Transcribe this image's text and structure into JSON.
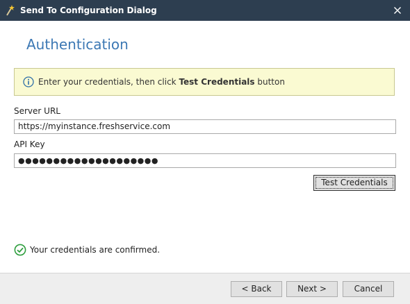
{
  "window": {
    "title": "Send To Configuration Dialog",
    "title_icon": "wand-icon",
    "close_icon": "close-icon",
    "titlebar_color": "#2d3e50"
  },
  "page": {
    "heading": "Authentication",
    "heading_color": "#3c78b4"
  },
  "info": {
    "icon": "info-icon",
    "text_before": "Enter your credentials, then click ",
    "text_bold": "Test Credentials",
    "text_after": " button",
    "background": "#fafad2"
  },
  "server_url": {
    "label": "Server URL",
    "value": "https://myinstance.freshservice.com"
  },
  "api_key": {
    "label": "API Key",
    "value": "●●●●●●●●●●●●●●●●●●●●"
  },
  "test_button": {
    "label": "Test Credentials"
  },
  "status": {
    "icon": "check-circle-icon",
    "text": "Your credentials are confirmed.",
    "color": "#2e9e3e"
  },
  "footer": {
    "back_label": "< Back",
    "next_label": "Next >",
    "cancel_label": "Cancel"
  }
}
